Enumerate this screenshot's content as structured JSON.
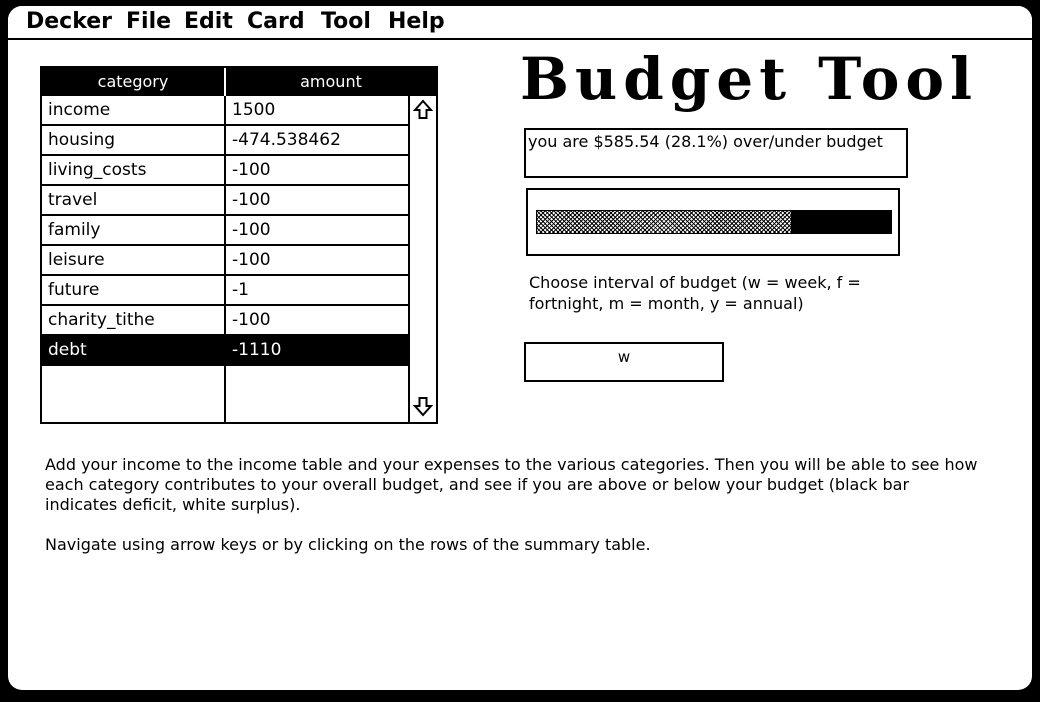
{
  "menubar": {
    "items": [
      "Decker",
      "File",
      "Edit",
      "Card",
      "Tool",
      "Help"
    ]
  },
  "table": {
    "headers": {
      "category": "category",
      "amount": "amount"
    },
    "rows": [
      {
        "category": "income",
        "amount": "1500"
      },
      {
        "category": "housing",
        "amount": "-474.538462"
      },
      {
        "category": "living_costs",
        "amount": "-100"
      },
      {
        "category": "travel",
        "amount": "-100"
      },
      {
        "category": "family",
        "amount": "-100"
      },
      {
        "category": "leisure",
        "amount": "-100"
      },
      {
        "category": "future",
        "amount": "-1"
      },
      {
        "category": "charity_tithe",
        "amount": "-100"
      },
      {
        "category": "debt",
        "amount": "-1110"
      }
    ],
    "selected_row": 8,
    "scroll_up_icon": "arrow-up-icon",
    "scroll_down_icon": "arrow-down-icon"
  },
  "title": "Budget Tool",
  "status": "you are $585.54 (28.1%) over/under budget",
  "budget_bar": {
    "surplus_fraction": 0.719
  },
  "interval": {
    "label": "Choose interval of budget (w = week, f = fortnight, m = month, y = annual)",
    "value": "w"
  },
  "help": {
    "paragraph1": "Add your income to the income table and your expenses to the various categories. Then you will be able to see how each category contributes to your overall budget, and see if you are above or below your budget (black bar indicates deficit, white surplus).",
    "paragraph2": "Navigate using arrow keys or by clicking on the rows of the summary table."
  }
}
